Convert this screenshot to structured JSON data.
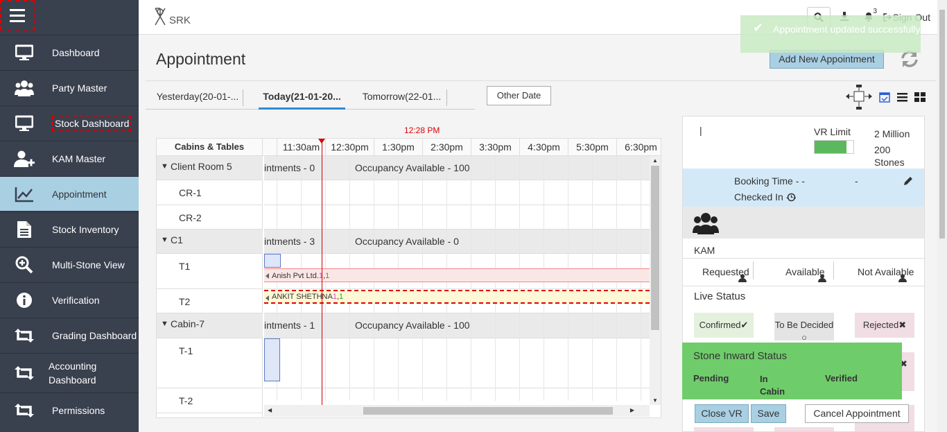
{
  "sidebar": {
    "items": [
      {
        "label": "Dashboard",
        "icon": "monitor-icon"
      },
      {
        "label": "Party Master",
        "icon": "users-icon"
      },
      {
        "label": "Stock Dashboard",
        "icon": "monitor-icon"
      },
      {
        "label": "KAM Master",
        "icon": "user-plus-icon"
      },
      {
        "label": "Appointment",
        "icon": "line-chart-icon"
      },
      {
        "label": "Stock Inventory",
        "icon": "document-icon"
      },
      {
        "label": "Multi-Stone View",
        "icon": "zoom-in-icon"
      },
      {
        "label": "Verification",
        "icon": "info-icon"
      },
      {
        "label": "Grading Dashboard",
        "icon": "retweet-icon"
      },
      {
        "label": "Accounting Dashboard",
        "icon": "retweet-icon"
      },
      {
        "label": "Permissions",
        "icon": "retweet-icon"
      }
    ]
  },
  "header": {
    "logo_text": "SRK",
    "notification_count": "3",
    "signout_label": "Sign Out"
  },
  "toast": {
    "message": "Appointment updated successfully"
  },
  "page": {
    "title": "Appointment",
    "add_button": "Add New Appointment",
    "tabs": [
      "Yesterday(20-01-...",
      "Today(21-01-20...",
      "Tomorrow(22-01..."
    ],
    "other_date": "Other Date"
  },
  "schedule": {
    "current_time": "12:28 PM",
    "cabins_header": "Cabins & Tables",
    "hours": [
      "11:30am",
      "12:30pm",
      "1:30pm",
      "2:30pm",
      "3:30pm",
      "4:30pm",
      "5:30pm",
      "6:30pm"
    ],
    "groups": [
      {
        "name": "Client Room 5",
        "appointments": "intments - 0",
        "occupancy": "Occupancy Available - 100",
        "tables": [
          "CR-1",
          "CR-2"
        ]
      },
      {
        "name": "C1",
        "appointments": "intments - 3",
        "occupancy": "Occupancy Available - 0",
        "tables": [
          "T1",
          "T2"
        ]
      },
      {
        "name": "Cabin-7",
        "appointments": "intments - 1",
        "occupancy": "Occupancy Available - 100",
        "tables": [
          "T-1",
          "T-2"
        ]
      }
    ],
    "bookings": [
      {
        "party": "Anish Pvt Ltd.",
        "a": "1",
        "b": "1"
      },
      {
        "party": "ANKIT SHETHNA",
        "a": "1",
        "b": "1"
      }
    ]
  },
  "details": {
    "pipe": "|",
    "vr_limit_label": "VR Limit",
    "vr_value": "2 Million",
    "stones_count": "200",
    "stones_label": "Stones",
    "booking_time": "Booking Time - -",
    "booking_dash": "-",
    "checked_in": "Checked In -",
    "checked_in_suffix": "-",
    "kam_label": "KAM",
    "availability": [
      "Requested",
      "Available",
      "Not Available"
    ],
    "live_status_title": "Live Status",
    "status_options": [
      {
        "label": "Confirmed",
        "mark": "✔",
        "bg": "#e3f1dd"
      },
      {
        "label": "To Be Decided",
        "mark": "○",
        "bg": "#e4e4e4"
      },
      {
        "label": "Rejected",
        "mark": "✖",
        "bg": "#f1dde4"
      }
    ],
    "stone_inward_title": "Stone Inward Status",
    "stone_inward_cols": [
      "Pending",
      "In Cabin",
      "Verified"
    ],
    "buttons": {
      "close_vr": "Close VR",
      "save": "Save",
      "cancel": "Cancel Appointment"
    }
  },
  "colors": {
    "sidebar": "#39404e",
    "active": "#a9cfe3",
    "accent": "#2d8bd7",
    "success": "#6fcc6a"
  }
}
